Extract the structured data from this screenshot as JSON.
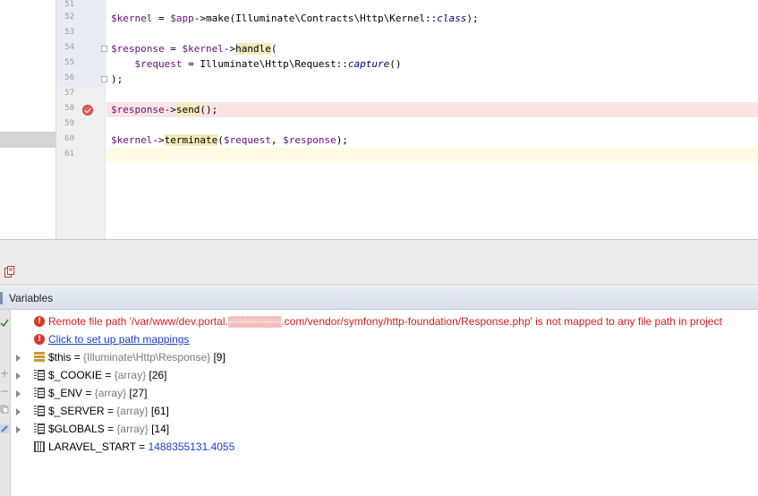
{
  "editor": {
    "lines": [
      {
        "num": "51",
        "text": ""
      },
      {
        "num": "52",
        "text": "$kernel = $app->make(Illuminate\\Contracts\\Http\\Kernel::class);"
      },
      {
        "num": "53",
        "text": ""
      },
      {
        "num": "54",
        "text": "$response = $kernel->handle("
      },
      {
        "num": "55",
        "text": "    $request = Illuminate\\Http\\Request::capture()"
      },
      {
        "num": "56",
        "text": ");"
      },
      {
        "num": "57",
        "text": ""
      },
      {
        "num": "58",
        "text": "$response->send();"
      },
      {
        "num": "59",
        "text": ""
      },
      {
        "num": "60",
        "text": "$kernel->terminate($request, $response);"
      },
      {
        "num": "61",
        "text": ""
      }
    ],
    "breakpoint_line": "58",
    "current_line": "61",
    "colors": {
      "breakpoint_bg": "#fae3e3",
      "current_line_bg": "#fffae3",
      "variable": "#660e7a"
    }
  },
  "debug": {
    "variables_title": "Variables",
    "messages": [
      {
        "text": "Remote file path '/var/www/dev.portal.▒▒▒▒▒▒▒.com/vendor/symfony/http-foundation/Response.php' is not mapped to any file path in project",
        "kind": "error"
      },
      {
        "text": "Click to set up path mappings",
        "kind": "link"
      }
    ],
    "variables": [
      {
        "name": "$this",
        "sep": " = ",
        "type": "{Illuminate\\Http\\Response}",
        "count": " [9]",
        "icon": "object-icon"
      },
      {
        "name": "$_COOKIE",
        "sep": " = ",
        "type": "{array}",
        "count": " [26]",
        "icon": "array-icon"
      },
      {
        "name": "$_ENV",
        "sep": " = ",
        "type": "{array}",
        "count": " [27]",
        "icon": "array-icon"
      },
      {
        "name": "$_SERVER",
        "sep": " = ",
        "type": "{array}",
        "count": " [61]",
        "icon": "array-icon"
      },
      {
        "name": "$GLOBALS",
        "sep": " = ",
        "type": "{array}",
        "count": " [14]",
        "icon": "array-icon"
      },
      {
        "name": "LARAVEL_START",
        "sep": " = ",
        "value": "1488355131.4055",
        "icon": "primitive-icon"
      }
    ]
  }
}
